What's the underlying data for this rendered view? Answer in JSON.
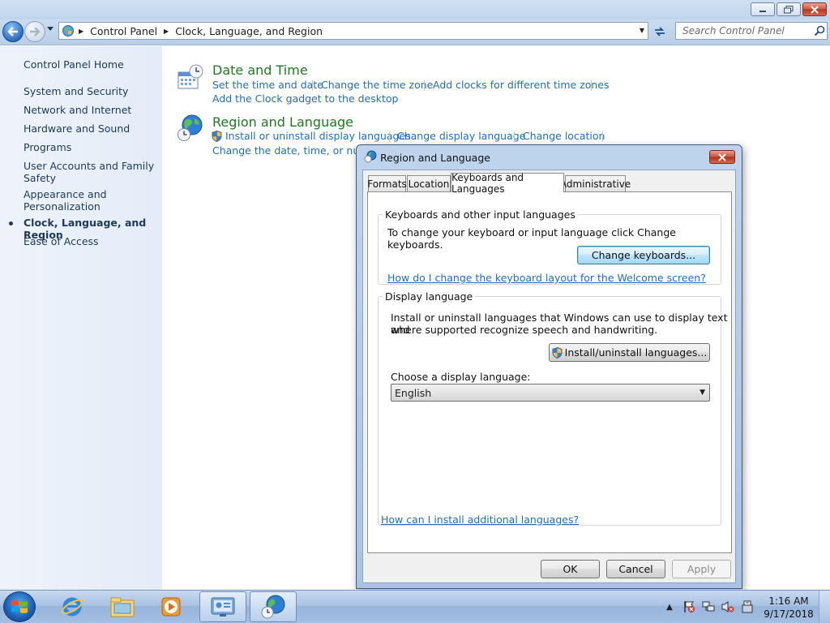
{
  "window": {
    "min_icon": "minimize-icon",
    "max_icon": "maximize-icon",
    "close_icon": "close-icon"
  },
  "address": {
    "crumbs": [
      "Control Panel",
      "Clock, Language, and Region"
    ],
    "search_placeholder": "Search Control Panel"
  },
  "sidebar": {
    "items": [
      {
        "label": "Control Panel Home"
      },
      {
        "label": "System and Security"
      },
      {
        "label": "Network and Internet"
      },
      {
        "label": "Hardware and Sound"
      },
      {
        "label": "Programs"
      },
      {
        "label": "User Accounts and Family Safety"
      },
      {
        "label": "Appearance and Personalization"
      },
      {
        "label": "Clock, Language, and Region",
        "current": true
      },
      {
        "label": "Ease of Access"
      }
    ]
  },
  "main": {
    "categories": [
      {
        "title": "Date and Time",
        "icon": "clock-calendar-icon",
        "links": [
          "Set the time and date",
          "Change the time zone",
          "Add clocks for different time zones",
          "Add the Clock gadget to the desktop"
        ]
      },
      {
        "title": "Region and Language",
        "icon": "globe-clock-icon",
        "links": [
          "Install or uninstall display languages",
          "Change display language",
          "Change location",
          "Change the date, time, or number"
        ]
      }
    ]
  },
  "dialog": {
    "title": "Region and Language",
    "tabs": [
      {
        "label": "Formats"
      },
      {
        "label": "Location"
      },
      {
        "label": "Keyboards and Languages",
        "active": true
      },
      {
        "label": "Administrative"
      }
    ],
    "keyboards_group": {
      "label": "Keyboards and other input languages",
      "text": "To change your keyboard or input language click Change keyboards.",
      "button": "Change keyboards...",
      "link": "How do I change the keyboard layout for the Welcome screen?"
    },
    "display_group": {
      "label": "Display language",
      "text_line1": "Install or uninstall languages that Windows can use to display text and",
      "text_line2": "where supported recognize speech and handwriting.",
      "button": "Install/uninstall languages...",
      "choose_label": "Choose a display language:",
      "selected": "English"
    },
    "bottom_link": "How can I install additional languages?",
    "buttons": {
      "ok": "OK",
      "cancel": "Cancel",
      "apply": "Apply"
    }
  },
  "taskbar": {
    "apps": [
      "internet-explorer-icon",
      "windows-explorer-icon",
      "media-player-icon",
      "control-panel-icon",
      "region-language-icon"
    ],
    "clock_time": "1:16 AM",
    "clock_date": "9/17/2018"
  }
}
